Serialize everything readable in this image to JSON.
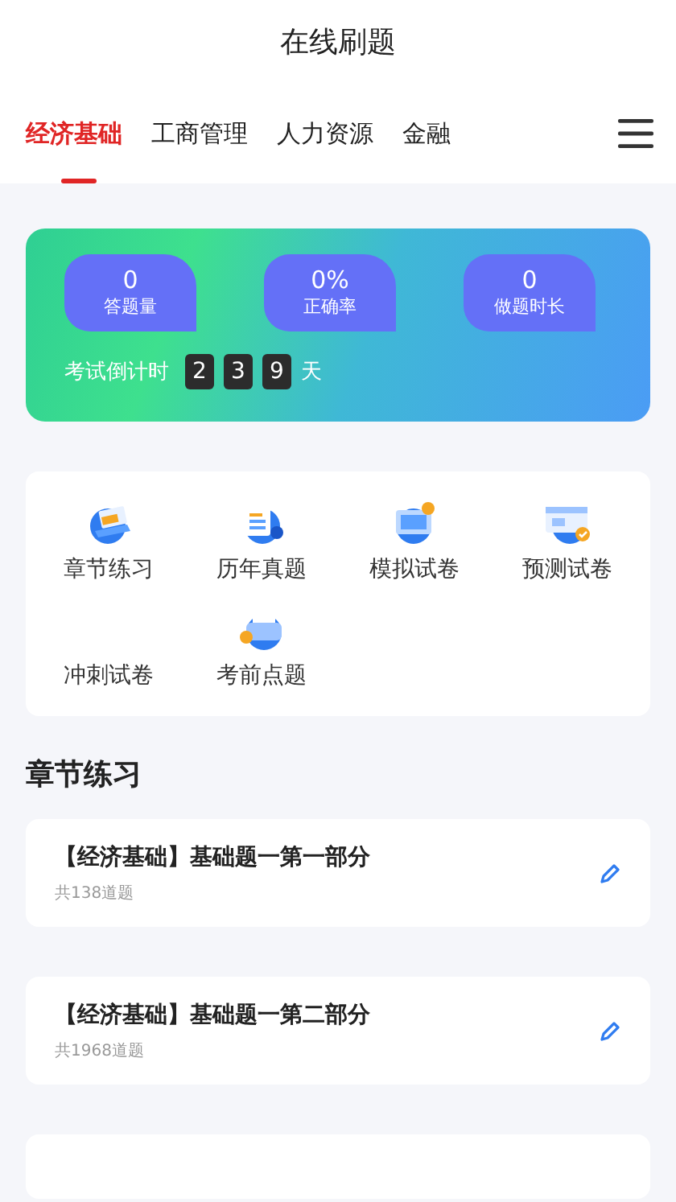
{
  "header": {
    "title": "在线刷题"
  },
  "tabs": [
    {
      "label": "经济基础",
      "selected": true
    },
    {
      "label": "工商管理",
      "selected": false
    },
    {
      "label": "人力资源",
      "selected": false
    },
    {
      "label": "金融",
      "selected": false
    }
  ],
  "stats": [
    {
      "value": "0",
      "label": "答题量"
    },
    {
      "value": "0%",
      "label": "正确率"
    },
    {
      "value": "0",
      "label": "做题时长"
    }
  ],
  "countdown": {
    "label": "考试倒计时",
    "digits": [
      "2",
      "3",
      "9"
    ],
    "unit": "天"
  },
  "modes": [
    {
      "label": "章节练习"
    },
    {
      "label": "历年真题"
    },
    {
      "label": "模拟试卷"
    },
    {
      "label": "预测试卷"
    },
    {
      "label": "冲刺试卷"
    },
    {
      "label": "考前点题"
    }
  ],
  "section": {
    "title": "章节练习"
  },
  "practice_sets": [
    {
      "title": "【经济基础】基础题一第一部分",
      "count": "共138道题"
    },
    {
      "title": "【经济基础】基础题一第二部分",
      "count": "共1968道题"
    }
  ]
}
